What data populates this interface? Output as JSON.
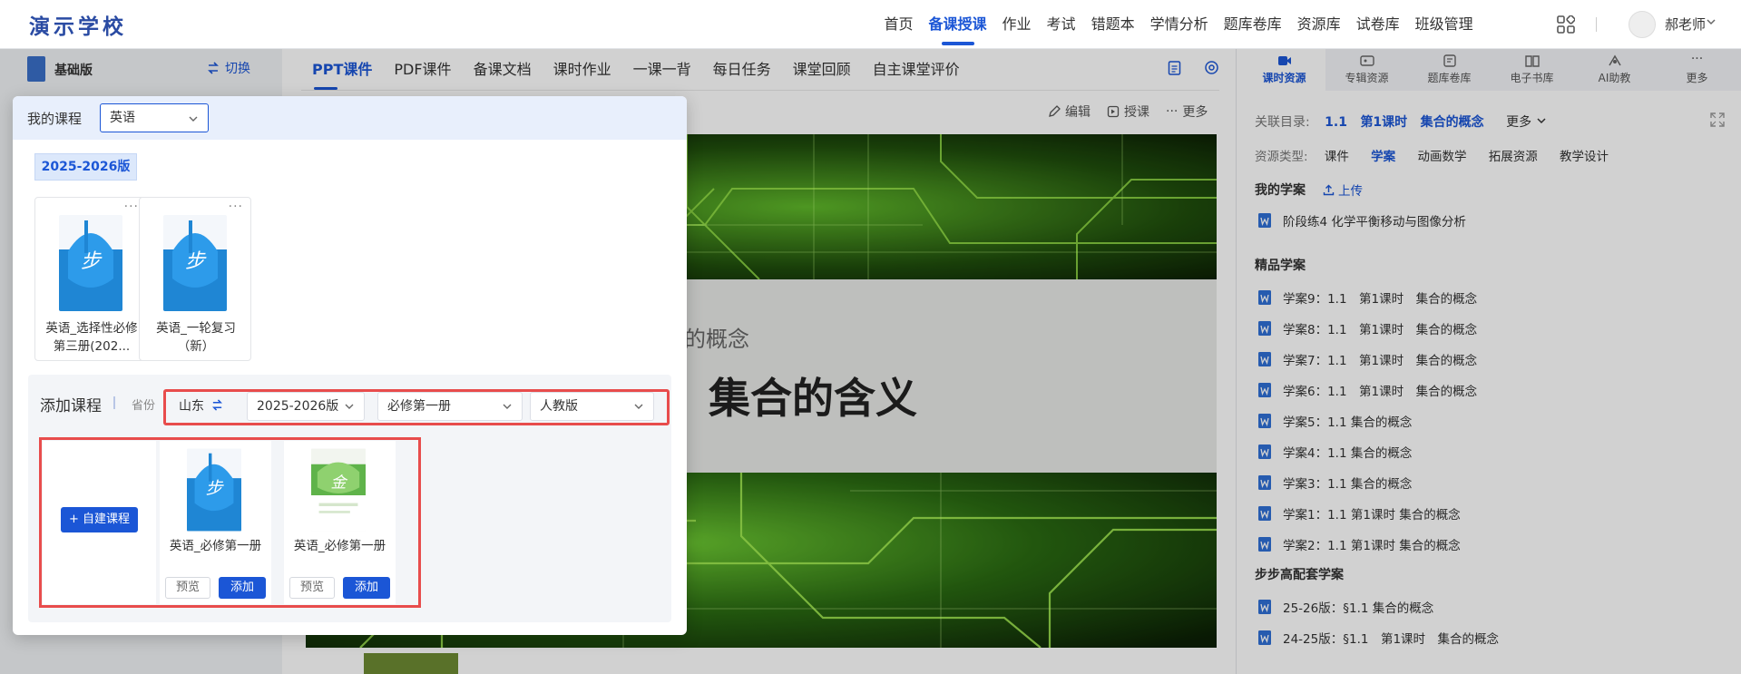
{
  "header": {
    "logo": "演示学校",
    "nav": [
      "首页",
      "备课授课",
      "作业",
      "考试",
      "错题本",
      "学情分析",
      "题库卷库",
      "资源库",
      "试卷库",
      "班级管理"
    ],
    "active_nav": "备课授课",
    "user": "郝老师",
    "accent_color": "#1b56d6"
  },
  "left": {
    "edition": "基础版",
    "switch_label": "切换"
  },
  "center": {
    "tabs": [
      "PPT课件",
      "PDF课件",
      "备课文档",
      "课时作业",
      "一课一背",
      "每日任务",
      "课堂回顾",
      "自主课堂评价"
    ],
    "active_tab": "PPT课件",
    "tools": [
      "编辑",
      "授课",
      "更多"
    ],
    "slide": {
      "subtitle": "合的概念",
      "title": "集合的含义"
    }
  },
  "right": {
    "tabs": [
      "课时资源",
      "专辑资源",
      "题库卷库",
      "电子书库",
      "AI助教",
      "更多"
    ],
    "active_tab": "课时资源",
    "catalog_label": "关联目录:",
    "catalog_parts": [
      "1.1",
      "第1课时",
      "集合的概念"
    ],
    "catalog_more": "更多",
    "type_label": "资源类型:",
    "types": [
      "课件",
      "学案",
      "动画数学",
      "拓展资源",
      "教学设计"
    ],
    "active_type": "学案",
    "my_section": "我的学案",
    "upload": "上传",
    "my_items": [
      "阶段练4 化学平衡移动与图像分析"
    ],
    "premium_section": "精品学案",
    "premium_items": [
      "学案9：1.1　第1课时　集合的概念",
      "学案8：1.1　第1课时　集合的概念",
      "学案7：1.1　第1课时　集合的概念",
      "学案6：1.1　第1课时　集合的概念",
      "学案5：1.1 集合的概念",
      "学案4：1.1 集合的概念",
      "学案3：1.1 集合的概念",
      "学案1：1.1 第1课时 集合的概念",
      "学案2：1.1 第1课时 集合的概念"
    ],
    "bubu_section": "步步高配套学案",
    "bubu_items": [
      "25-26版：§1.1 集合的概念",
      "24-25版：§1.1　第1课时　集合的概念"
    ]
  },
  "popover": {
    "my_course_label": "我的课程",
    "course_value": "英语",
    "year_tag": "2025-2026版",
    "my_courses": [
      {
        "title": "英语_选择性必修第三册(202...",
        "more": "···"
      },
      {
        "title": "英语_一轮复习（新）",
        "more": "···"
      }
    ],
    "add_label": "添加课程",
    "province_label": "省份",
    "filters": {
      "province": "山东",
      "year": "2025-2026版",
      "volume": "必修第一册",
      "publisher": "人教版"
    },
    "self_build": "自建课程",
    "add_courses": [
      {
        "title": "英语_必修第一册",
        "preview": "预览",
        "add": "添加"
      },
      {
        "title": "英语_必修第一册",
        "preview": "预览",
        "add": "添加"
      }
    ]
  }
}
